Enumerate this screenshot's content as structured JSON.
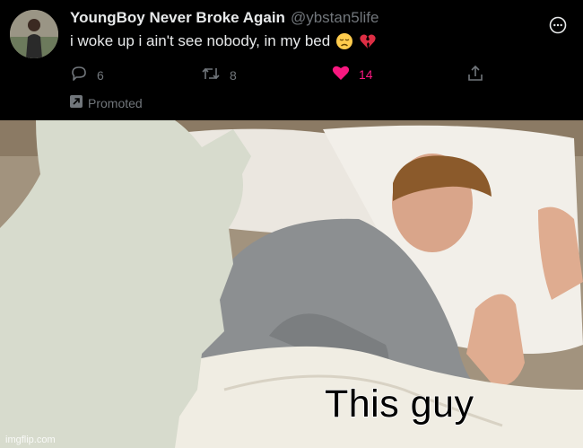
{
  "tweet": {
    "display_name": "YoungBoy Never Broke Again",
    "handle": "@ybstan5life",
    "text": "i woke up i ain't see nobody, in my bed",
    "emojis": [
      "disappointed-face",
      "broken-heart"
    ],
    "reply_count": "6",
    "retweet_count": "8",
    "like_count": "14",
    "promoted_label": "Promoted",
    "like_color": "#f91880"
  },
  "meme": {
    "caption": "This guy",
    "watermark": "imgflip.com"
  }
}
